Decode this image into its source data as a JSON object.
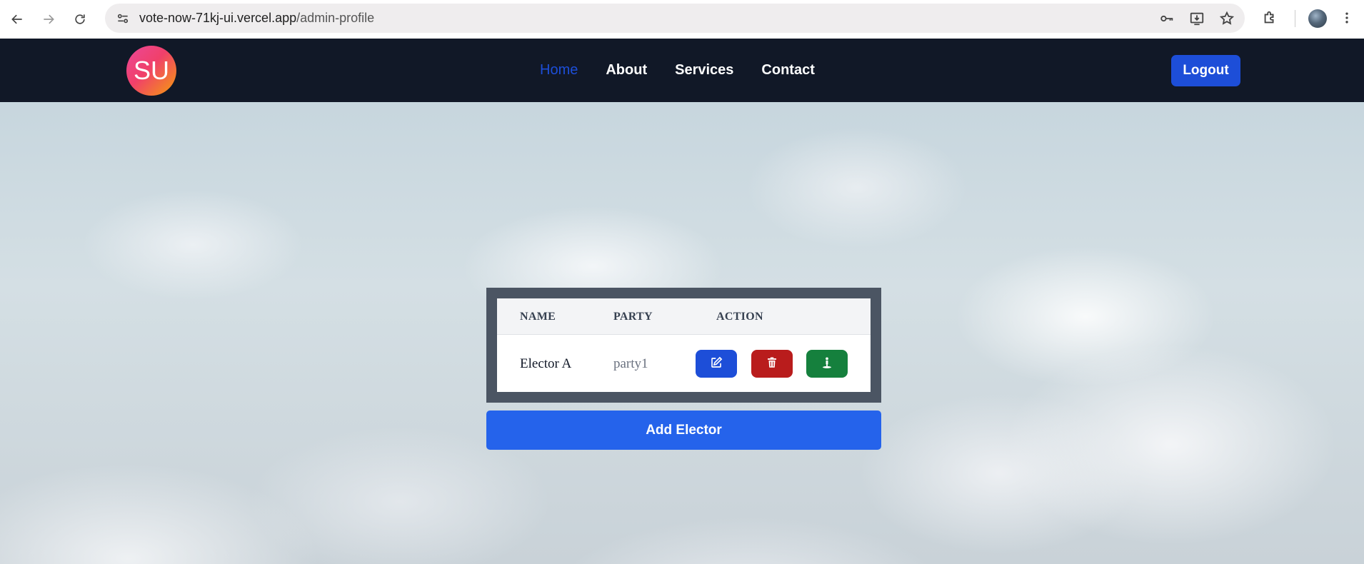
{
  "browser": {
    "url_host": "vote-now-71kj-ui.vercel.app",
    "url_path": "/admin-profile"
  },
  "header": {
    "logo_text": "SU",
    "nav": [
      {
        "label": "Home",
        "active": true
      },
      {
        "label": "About",
        "active": false
      },
      {
        "label": "Services",
        "active": false
      },
      {
        "label": "Contact",
        "active": false
      }
    ],
    "logout_label": "Logout"
  },
  "table": {
    "columns": [
      "NAME",
      "PARTY",
      "ACTION"
    ],
    "rows": [
      {
        "name": "Elector A",
        "party": "party1"
      }
    ]
  },
  "add_elector_label": "Add Elector",
  "icons": {
    "edit": "edit-icon",
    "delete": "trash-icon",
    "vote": "vote-person-icon"
  },
  "colors": {
    "header_bg": "#111827",
    "nav_active": "#1d4ed8",
    "primary": "#2563eb",
    "danger": "#b91c1c",
    "success": "#15803d",
    "table_frame": "#4b5563"
  }
}
